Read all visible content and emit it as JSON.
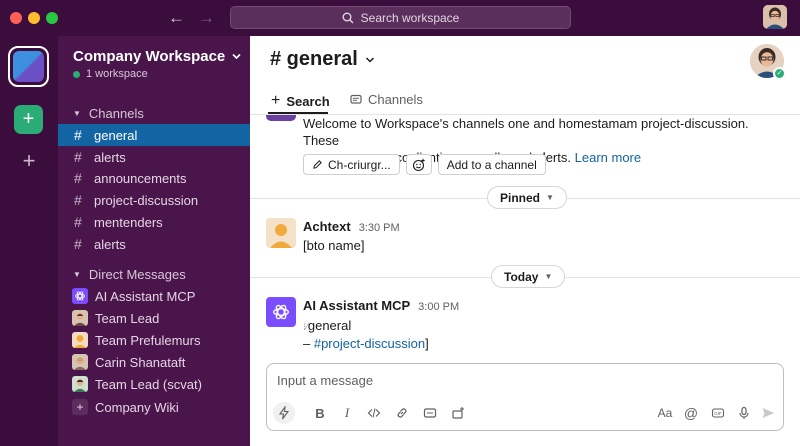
{
  "titlebar": {
    "search_placeholder": "Search workspace"
  },
  "workspace": {
    "name": "Company Workspace",
    "subtitle": "1 workspace"
  },
  "sidebar": {
    "channels_header": "Channels",
    "channels": [
      {
        "label": "general",
        "active": true
      },
      {
        "label": "alerts",
        "active": false
      },
      {
        "label": "announcements",
        "active": false
      },
      {
        "label": "project-discussion",
        "active": false
      },
      {
        "label": "mentenders",
        "active": false
      },
      {
        "label": "alerts",
        "active": false
      }
    ],
    "dm_header": "Direct Messages",
    "dms": [
      {
        "label": "AI Assistant MCP",
        "avatar": "ai-icon"
      },
      {
        "label": "Team Lead",
        "avatar": "person"
      },
      {
        "label": "Team Prefulemurs",
        "avatar": "person"
      },
      {
        "label": "Carin Shanataft",
        "avatar": "person"
      },
      {
        "label": "Team Lead (scvat)",
        "avatar": "person"
      },
      {
        "label": "Company Wiki",
        "avatar": "plus-icon"
      }
    ]
  },
  "main": {
    "channel_title": "# general",
    "tabs": {
      "search": "Search",
      "channels": "Channels"
    },
    "welcome": {
      "line1": "Welcome to Workspace's channels one and homestamam project-discussion. These",
      "line2": "messagees are conlivnting as well sand ≉lerts.",
      "link": "Learn more"
    },
    "actions": {
      "configure": "Ch-criurgr...",
      "add_channel": "Add to a channel"
    },
    "pinned_label": "Pinned",
    "today_label": "Today",
    "messages": [
      {
        "name": "Achtext",
        "time": "3:30 PM",
        "lines": [
          "[bto name]"
        ]
      },
      {
        "name": "AI Assistant MCP",
        "time": "3:00 PM",
        "line1": "general",
        "line2_prefix": "– ",
        "line2_link": "#project-discussion",
        "line2_suffix": "]"
      }
    ],
    "composer": {
      "placeholder": "Input a message"
    }
  },
  "colors": {
    "sidebar_bg": "#4a154b",
    "rail_bg": "#3b0d3c",
    "active_channel": "#1264a3",
    "online": "#2bac76",
    "ai_purple": "#7c4dff",
    "link": "#1264a3"
  }
}
